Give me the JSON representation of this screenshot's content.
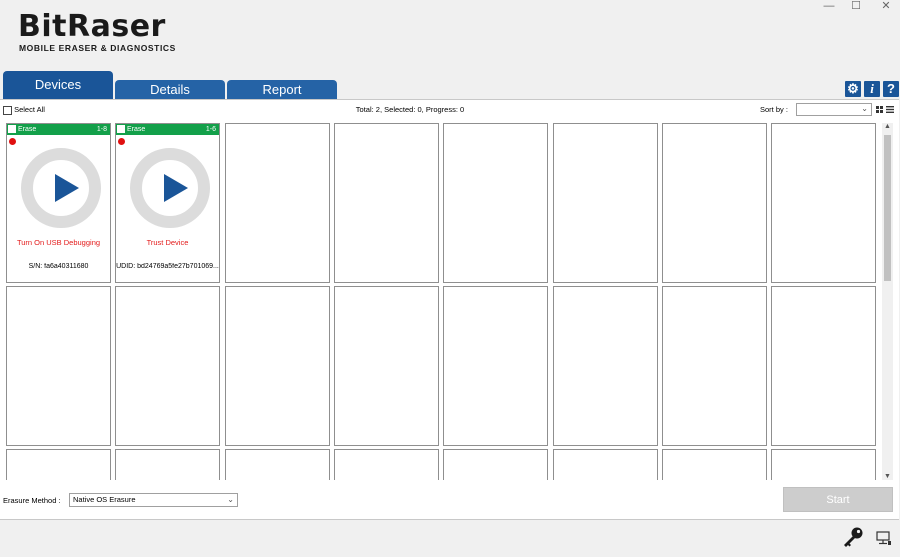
{
  "window": {
    "minimize": "—",
    "maximize": "☐",
    "close": "✕"
  },
  "logo": {
    "name": "BitRaser",
    "tagline": "MOBILE ERASER & DIAGNOSTICS"
  },
  "tabs": [
    {
      "label": "Devices",
      "active": true
    },
    {
      "label": "Details",
      "active": false
    },
    {
      "label": "Report",
      "active": false
    }
  ],
  "tools": {
    "settings": "⚙",
    "info": "i",
    "help": "?"
  },
  "toolbar": {
    "select_all": "Select All",
    "summary": "Total: 2, Selected: 0, Progress: 0",
    "sort_by": "Sort by :",
    "sort_value": ""
  },
  "devices": [
    {
      "action": "Erase",
      "port": "1-8",
      "status": "Turn On USB Debugging",
      "identifier": "S/N: fa6a40311680"
    },
    {
      "action": "Erase",
      "port": "1-6",
      "status": "Trust Device",
      "identifier": "UDID: bd24769a5fe27b701069..."
    }
  ],
  "footer": {
    "erasure_method_label": "Erasure Method :",
    "erasure_method_value": "Native OS Erasure",
    "start_label": "Start"
  },
  "colors": {
    "accent": "#1a5598",
    "card_header": "#13a04a",
    "status_text": "#e31b1b"
  }
}
